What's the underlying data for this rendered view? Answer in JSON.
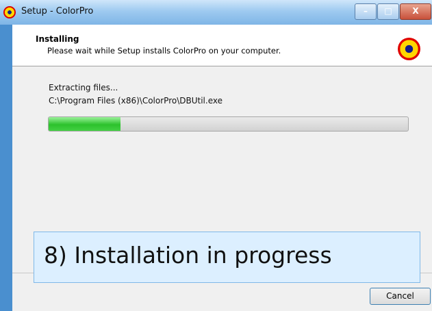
{
  "window": {
    "title": "Setup - ColorPro",
    "buttons": {
      "minimize": "–",
      "maximize": "□",
      "close": "X"
    }
  },
  "header": {
    "heading": "Installing",
    "subheading": "Please wait while Setup installs ColorPro on your computer."
  },
  "status": {
    "line1": "Extracting files...",
    "line2": "C:\\Program Files (x86)\\ColorPro\\DBUtil.exe"
  },
  "progress": {
    "fraction": 0.2
  },
  "footer": {
    "cancel_label": "Cancel"
  },
  "caption": {
    "text": "8) Installation in progress"
  },
  "colors": {
    "accent": "#4a8fcf",
    "progress_green": "#2cc12c"
  },
  "icons": {
    "app": "colorpro-logo-icon",
    "header_logo": "colorpro-logo-icon"
  }
}
